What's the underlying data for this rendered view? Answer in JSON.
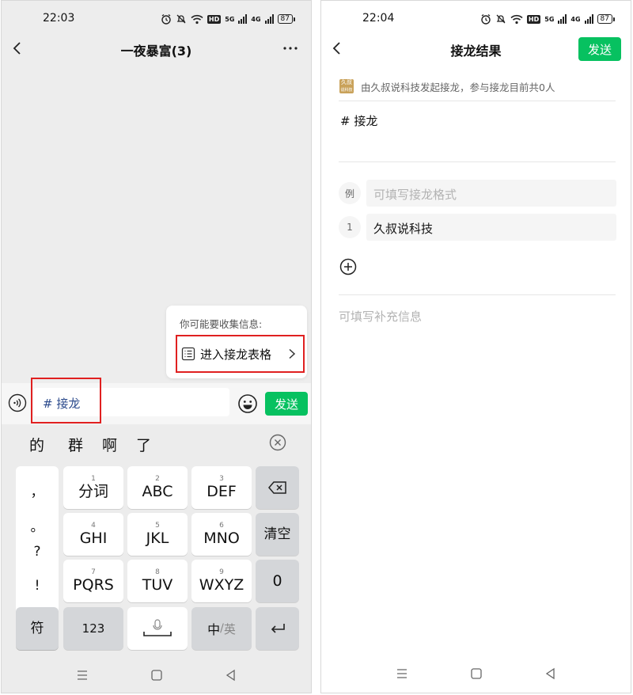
{
  "left": {
    "status": {
      "time": "22:03",
      "battery": "87",
      "hd_label": "HD",
      "net1": "5G",
      "net2": "4G"
    },
    "chat_title": "一夜暴富(3)",
    "suggestion": {
      "title": "你可能要收集信息:",
      "action": "进入接龙表格"
    },
    "input": {
      "value": "# 接龙",
      "send_label": "发送"
    },
    "keyboard": {
      "candidates": [
        "的",
        "群",
        "啊",
        "了"
      ],
      "punctuation": [
        "，",
        "。",
        "?",
        "!"
      ],
      "rows": [
        [
          {
            "num": "1",
            "label": "分词"
          },
          {
            "num": "2",
            "label": "ABC"
          },
          {
            "num": "3",
            "label": "DEF"
          }
        ],
        [
          {
            "num": "4",
            "label": "GHI"
          },
          {
            "num": "5",
            "label": "JKL"
          },
          {
            "num": "6",
            "label": "MNO"
          }
        ],
        [
          {
            "num": "7",
            "label": "PQRS"
          },
          {
            "num": "8",
            "label": "TUV"
          },
          {
            "num": "9",
            "label": "WXYZ"
          }
        ]
      ],
      "side_keys": {
        "delete": "delete-icon",
        "clear": "清空",
        "zero": "0"
      },
      "bottom_row": {
        "symbols": "符",
        "numbers": "123",
        "lang_cn": "中",
        "lang_sep": "/",
        "lang_en": "英"
      }
    }
  },
  "right": {
    "status": {
      "time": "22:04",
      "battery": "87",
      "hd_label": "HD",
      "net1": "5G",
      "net2": "4G"
    },
    "title": "接龙结果",
    "send_label": "发送",
    "info": {
      "avatar_text_1": "久叔",
      "avatar_text_2": "说科技",
      "text": "由久叔说科技发起接龙，参与接龙目前共0人"
    },
    "topic": "# 接龙",
    "example": {
      "badge": "例",
      "placeholder": "可填写接龙格式"
    },
    "entries": [
      {
        "index": "1",
        "value": "久叔说科技"
      }
    ],
    "extra_placeholder": "可填写补充信息"
  },
  "colors": {
    "accent_green": "#07c160",
    "highlight_red": "#e02020",
    "input_text_blue": "#2b4a8c"
  }
}
